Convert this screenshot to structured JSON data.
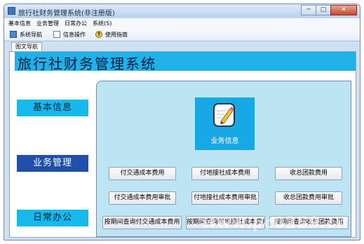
{
  "window": {
    "title": "旅行社财务管理系统(非注册版)",
    "controls": {
      "minimize": "─",
      "maximize": "□",
      "close": "✕"
    }
  },
  "menu": [
    "基本信息",
    "业务管理",
    "日常办公",
    "系统(S)"
  ],
  "toolbar": {
    "nav": "系统导航",
    "info": "信息操作",
    "help": "使用指南",
    "help_glyph": "?"
  },
  "tab": "图文导航",
  "banner": {
    "title": "旅行社财务管理系统"
  },
  "nav": {
    "basic": "基本信息",
    "business": "业务管理",
    "office": "日常办公"
  },
  "tile": {
    "label": "业务信息"
  },
  "actions": {
    "row1": [
      "付交通成本费用",
      "付地接社成本费用",
      "收总团款费用"
    ],
    "row2": [
      "付交通成本费用审批",
      "付地接社成本费用审批",
      "收总团款费用审批"
    ],
    "row3": [
      "按期间查询付交通成本费用",
      "按期间查询付地接社成本费用",
      "按期间查询收总团款费用"
    ]
  },
  "watermark": "www.pc0359.cn",
  "colors": {
    "banner": "#1fb2e8",
    "nav_active": "#1f4fa8",
    "panel": "#bde4f3"
  }
}
